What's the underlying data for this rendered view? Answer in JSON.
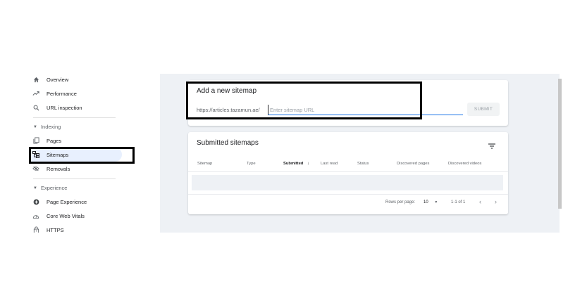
{
  "sidebar": {
    "items_top": [
      {
        "label": "Overview",
        "icon": "home-icon"
      },
      {
        "label": "Performance",
        "icon": "trending-up-icon"
      },
      {
        "label": "URL inspection",
        "icon": "search-icon"
      }
    ],
    "indexing_header": "Indexing",
    "indexing_items": [
      {
        "label": "Pages",
        "icon": "pages-icon"
      },
      {
        "label": "Sitemaps",
        "icon": "sitemap-icon"
      },
      {
        "label": "Removals",
        "icon": "removals-icon"
      }
    ],
    "experience_header": "Experience",
    "experience_items": [
      {
        "label": "Page Experience",
        "icon": "page-experience-icon"
      },
      {
        "label": "Core Web Vitals",
        "icon": "speedometer-icon"
      },
      {
        "label": "HTTPS",
        "icon": "lock-icon"
      }
    ]
  },
  "add_sitemap": {
    "title": "Add a new sitemap",
    "url_prefix": "https://articles.tazamun.ae/",
    "input_value": "",
    "input_placeholder": "Enter sitemap URL",
    "submit_label": "SUBMIT"
  },
  "submitted": {
    "title": "Submitted sitemaps",
    "columns": [
      "Sitemap",
      "Type",
      "Submitted",
      "Last read",
      "Status",
      "Discovered pages",
      "Discovered videos"
    ],
    "sort_arrow": "↓",
    "pagination": {
      "rows_per_page_label": "Rows per page:",
      "rows_per_page_value": "10",
      "range": "1-1 of 1",
      "prev": "‹",
      "next": "›"
    }
  },
  "colors": {
    "accent": "#1a73e8",
    "active_bg": "#e8f0fe",
    "page_bg": "#eef1f5"
  }
}
